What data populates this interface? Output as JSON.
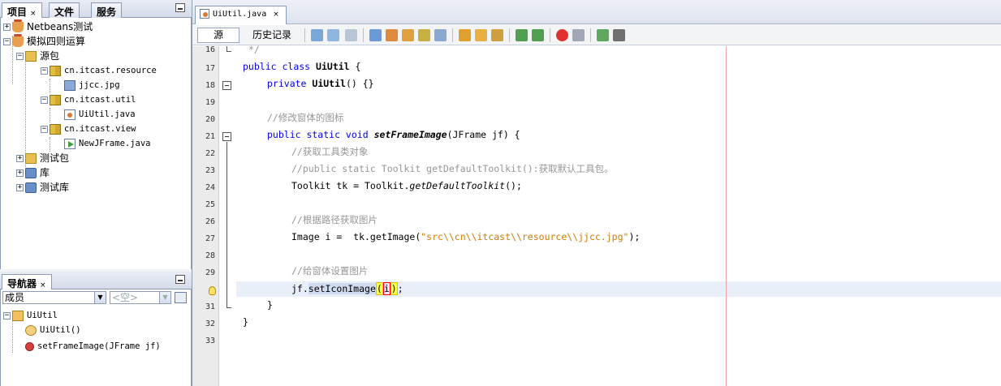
{
  "left_top_panel": {
    "tabs": [
      {
        "label": "项目",
        "close": "×"
      },
      {
        "label": "文件"
      },
      {
        "label": "服务"
      }
    ],
    "tree": [
      {
        "label": "Netbeans测试",
        "icon": "coffee-cup-icon",
        "expander": "+"
      },
      {
        "label": "模拟四则运算",
        "icon": "coffee-cup-icon",
        "expander": "−"
      },
      {
        "label": "源包",
        "icon": "source-folder-icon",
        "expander": "−"
      },
      {
        "label": "cn.itcast.resource",
        "icon": "package-icon",
        "expander": "−"
      },
      {
        "label": "jjcc.jpg",
        "icon": "image-file-icon"
      },
      {
        "label": "cn.itcast.util",
        "icon": "package-icon",
        "expander": "−"
      },
      {
        "label": "UiUtil.java",
        "icon": "java-file-icon"
      },
      {
        "label": "cn.itcast.view",
        "icon": "package-icon",
        "expander": "−"
      },
      {
        "label": "NewJFrame.java",
        "icon": "form-file-icon"
      },
      {
        "label": "测试包",
        "icon": "test-folder-icon",
        "expander": "+"
      },
      {
        "label": "库",
        "icon": "library-icon",
        "expander": "+"
      },
      {
        "label": "测试库",
        "icon": "library-icon",
        "expander": "+"
      }
    ]
  },
  "navigator_panel": {
    "tab_label": "导航器",
    "tab_close": "×",
    "filter_value": "成员",
    "secondary_value": "<空>",
    "tree": [
      {
        "label": "UiUtil",
        "icon": "class-icon",
        "expander": "−"
      },
      {
        "label": "UiUtil()",
        "icon": "constructor-icon"
      },
      {
        "label": "setFrameImage(JFrame jf)",
        "icon": "method-icon"
      }
    ]
  },
  "editor": {
    "tab_label": "UiUtil.java",
    "tab_close": "×",
    "mode_source": "源",
    "mode_history": "历史记录",
    "line_numbers": [
      "16",
      "17",
      "18",
      "19",
      "20",
      "21",
      "22",
      "23",
      "24",
      "25",
      "26",
      "27",
      "28",
      "29",
      "30",
      "31",
      "32",
      "33"
    ],
    "code": {
      "l16": " */",
      "l17_kw1": "public",
      "l17_kw2": "class",
      "l17_name": "UiUtil",
      "l17_rest": " {",
      "l18_kw": "private",
      "l18_name": "UiUtil",
      "l18_rest": "() {}",
      "l20_comment": "//修改窗体的图标",
      "l21_kw": "public static void",
      "l21_name": "setFrameImage",
      "l21_rest": "(JFrame jf) {",
      "l22_comment": "//获取工具类对象",
      "l23_comment": "//public static Toolkit getDefaultToolkit():获取默认工具包。",
      "l24_pre": "Toolkit tk = Toolkit.",
      "l24_call": "getDefaultToolkit",
      "l24_rest": "();",
      "l26_comment": "//根据路径获取图片",
      "l27_pre": "Image i =  tk.getImage(",
      "l27_str": "\"src\\\\cn\\\\itcast\\\\resource\\\\jjcc.jpg\"",
      "l27_rest": ");",
      "l29_comment": "//给窗体设置图片",
      "l30_pre": "jf.",
      "l30_sel": "setIconImage",
      "l30_open": "(",
      "l30_arg": "i",
      "l30_close": ")",
      "l30_end": ";",
      "l31": "}",
      "l32": "}"
    }
  },
  "colors": {
    "keyword": "#0000e6",
    "comment": "#969696",
    "string": "#ce7b00",
    "current_line": "#e9eff8"
  }
}
